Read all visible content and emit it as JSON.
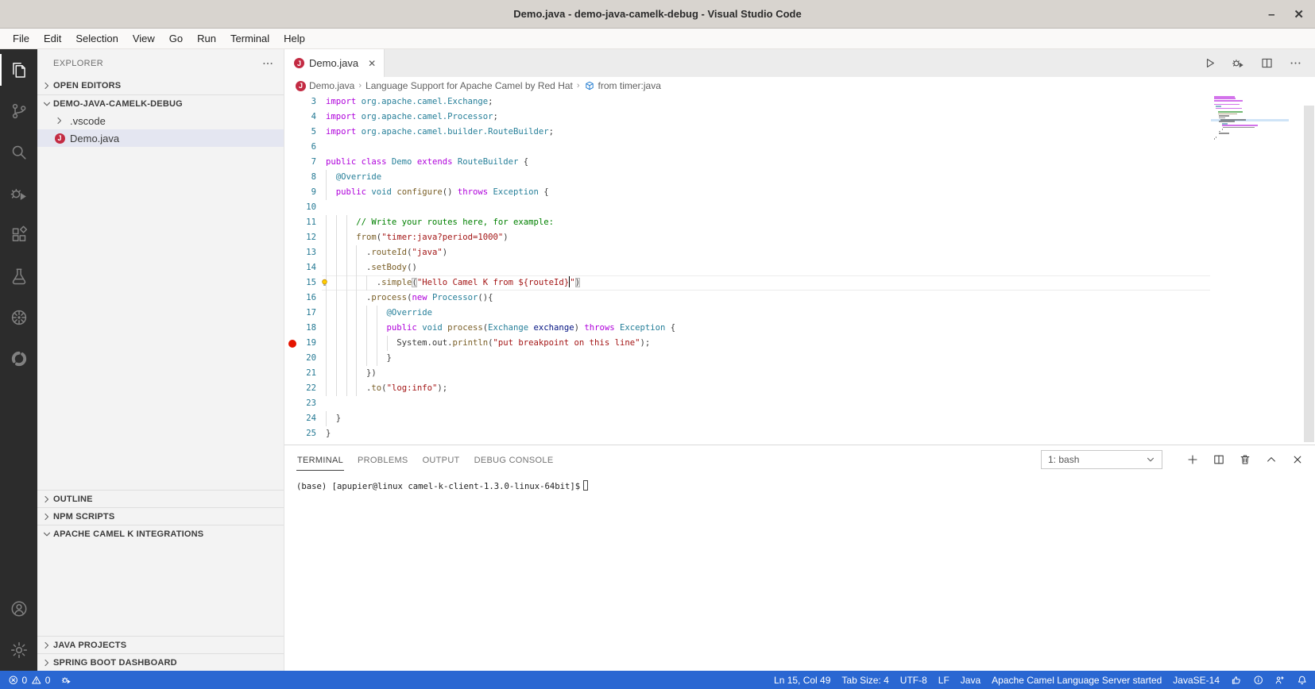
{
  "window": {
    "title": "Demo.java - demo-java-camelk-debug - Visual Studio Code",
    "controls": [
      {
        "name": "minimize-button",
        "glyph": "–"
      },
      {
        "name": "close-window-button",
        "glyph": "✕"
      }
    ]
  },
  "menu": {
    "items": [
      "File",
      "Edit",
      "Selection",
      "View",
      "Go",
      "Run",
      "Terminal",
      "Help"
    ]
  },
  "activity_bar": {
    "top": [
      {
        "name": "explorer",
        "icon": "files-icon",
        "active": true
      },
      {
        "name": "source-control",
        "icon": "source-control-icon",
        "active": false
      },
      {
        "name": "search",
        "icon": "search-icon",
        "active": false
      },
      {
        "name": "run-and-debug",
        "icon": "debug-alt-icon",
        "active": false
      },
      {
        "name": "extensions",
        "icon": "extensions-icon",
        "active": false
      },
      {
        "name": "testing",
        "icon": "beaker-icon",
        "active": false
      },
      {
        "name": "kubernetes",
        "icon": "kubernetes-icon",
        "active": false
      },
      {
        "name": "camel-k",
        "icon": "camel-k-icon",
        "active": false
      }
    ],
    "bottom": [
      {
        "name": "accounts",
        "icon": "account-icon",
        "active": false
      },
      {
        "name": "settings",
        "icon": "gear-icon",
        "active": false
      }
    ]
  },
  "sidebar": {
    "header": "EXPLORER",
    "top_rows": [
      {
        "kind": "section",
        "label": "OPEN EDITORS",
        "chevron": "right"
      },
      {
        "kind": "section",
        "label": "DEMO-JAVA-CAMELK-DEBUG",
        "chevron": "down",
        "border_top": true
      },
      {
        "kind": "folder",
        "label": ".vscode",
        "chevron": "right"
      },
      {
        "kind": "file",
        "label": "Demo.java",
        "icon": "java-file-icon",
        "selected": true
      }
    ],
    "bottom_rows": [
      {
        "kind": "section",
        "label": "OUTLINE",
        "chevron": "right",
        "border_top": true
      },
      {
        "kind": "section",
        "label": "NPM SCRIPTS",
        "chevron": "right",
        "border_top": true
      },
      {
        "kind": "section",
        "label": "APACHE CAMEL K INTEGRATIONS",
        "chevron": "down",
        "border_top": true
      },
      {
        "kind": "spacer",
        "height": 118
      },
      {
        "kind": "section",
        "label": "JAVA PROJECTS",
        "chevron": "right",
        "border_top": true
      },
      {
        "kind": "section",
        "label": "SPRING BOOT DASHBOARD",
        "chevron": "right",
        "border_top": true
      }
    ]
  },
  "editor": {
    "tab": {
      "label": "Demo.java",
      "icon": "java-file-icon",
      "close_glyph": "✕"
    },
    "actions": [
      {
        "name": "run-file",
        "icon": "run-icon"
      },
      {
        "name": "debug-run-file",
        "icon": "debug-alt-icon"
      },
      {
        "name": "split-editor",
        "icon": "split-icon"
      },
      {
        "name": "more-actions",
        "icon": "ellipsis-icon"
      }
    ],
    "breadcrumb": [
      {
        "label": "Demo.java",
        "icon": "java-file-icon"
      },
      {
        "label": "Language Support for Apache Camel by Red Hat"
      },
      {
        "label": "from timer:java",
        "icon": "camel-route-icon"
      }
    ],
    "code": {
      "first_line": 3,
      "current_line": 15,
      "breakpoint_lines": [
        19
      ],
      "lightbulb_line": 15,
      "lines": [
        {
          "n": 3,
          "s": [
            {
              "c": "kw",
              "t": "import "
            },
            {
              "c": "type",
              "t": "org.apache.camel.Exchange"
            },
            {
              "c": "plain",
              "t": ";"
            }
          ]
        },
        {
          "n": 4,
          "s": [
            {
              "c": "kw",
              "t": "import "
            },
            {
              "c": "type",
              "t": "org.apache.camel.Processor"
            },
            {
              "c": "plain",
              "t": ";"
            }
          ]
        },
        {
          "n": 5,
          "s": [
            {
              "c": "kw",
              "t": "import "
            },
            {
              "c": "type",
              "t": "org.apache.camel.builder.RouteBuilder"
            },
            {
              "c": "plain",
              "t": ";"
            }
          ]
        },
        {
          "n": 6,
          "s": []
        },
        {
          "n": 7,
          "s": [
            {
              "c": "kw",
              "t": "public class "
            },
            {
              "c": "type",
              "t": "Demo"
            },
            {
              "c": "kw",
              "t": " extends "
            },
            {
              "c": "type",
              "t": "RouteBuilder"
            },
            {
              "c": "plain",
              "t": " {"
            }
          ]
        },
        {
          "n": 8,
          "s": [
            {
              "c": "plain",
              "t": "  "
            },
            {
              "c": "type",
              "t": "@Override"
            }
          ]
        },
        {
          "n": 9,
          "s": [
            {
              "c": "plain",
              "t": "  "
            },
            {
              "c": "kw",
              "t": "public "
            },
            {
              "c": "type",
              "t": "void "
            },
            {
              "c": "method",
              "t": "configure"
            },
            {
              "c": "plain",
              "t": "() "
            },
            {
              "c": "kw",
              "t": "throws "
            },
            {
              "c": "type",
              "t": "Exception"
            },
            {
              "c": "plain",
              "t": " {"
            }
          ]
        },
        {
          "n": 10,
          "s": []
        },
        {
          "n": 11,
          "s": [
            {
              "c": "comment",
              "t": "      // Write your routes here, for example:"
            }
          ]
        },
        {
          "n": 12,
          "s": [
            {
              "c": "plain",
              "t": "      "
            },
            {
              "c": "method",
              "t": "from"
            },
            {
              "c": "plain",
              "t": "("
            },
            {
              "c": "string",
              "t": "\"timer:java?period=1000\""
            },
            {
              "c": "plain",
              "t": ")"
            }
          ]
        },
        {
          "n": 13,
          "s": [
            {
              "c": "plain",
              "t": "        ."
            },
            {
              "c": "method",
              "t": "routeId"
            },
            {
              "c": "plain",
              "t": "("
            },
            {
              "c": "string",
              "t": "\"java\""
            },
            {
              "c": "plain",
              "t": ")"
            }
          ]
        },
        {
          "n": 14,
          "s": [
            {
              "c": "plain",
              "t": "        ."
            },
            {
              "c": "method",
              "t": "setBody"
            },
            {
              "c": "plain",
              "t": "()"
            }
          ]
        },
        {
          "n": 15,
          "s": [
            {
              "c": "plain",
              "t": "          ."
            },
            {
              "c": "method",
              "t": "simple"
            },
            {
              "c": "plain",
              "t": "(",
              "bracket": true
            },
            {
              "c": "string",
              "t": "\"Hello Camel K from ${routeId}"
            },
            {
              "cursor": true
            },
            {
              "c": "string",
              "t": "\""
            },
            {
              "c": "plain",
              "t": ")",
              "bracket": true
            }
          ]
        },
        {
          "n": 16,
          "s": [
            {
              "c": "plain",
              "t": "        ."
            },
            {
              "c": "method",
              "t": "process"
            },
            {
              "c": "plain",
              "t": "("
            },
            {
              "c": "kw",
              "t": "new "
            },
            {
              "c": "type",
              "t": "Processor"
            },
            {
              "c": "plain",
              "t": "(){"
            }
          ]
        },
        {
          "n": 17,
          "s": [
            {
              "c": "plain",
              "t": "            "
            },
            {
              "c": "type",
              "t": "@Override"
            }
          ]
        },
        {
          "n": 18,
          "s": [
            {
              "c": "plain",
              "t": "            "
            },
            {
              "c": "kw",
              "t": "public "
            },
            {
              "c": "type",
              "t": "void "
            },
            {
              "c": "method",
              "t": "process"
            },
            {
              "c": "plain",
              "t": "("
            },
            {
              "c": "type",
              "t": "Exchange "
            },
            {
              "c": "param",
              "t": "exchange"
            },
            {
              "c": "plain",
              "t": ") "
            },
            {
              "c": "kw",
              "t": "throws "
            },
            {
              "c": "type",
              "t": "Exception"
            },
            {
              "c": "plain",
              "t": " {"
            }
          ]
        },
        {
          "n": 19,
          "s": [
            {
              "c": "plain",
              "t": "              System.out."
            },
            {
              "c": "method",
              "t": "println"
            },
            {
              "c": "plain",
              "t": "("
            },
            {
              "c": "string",
              "t": "\"put breakpoint on this line\""
            },
            {
              "c": "plain",
              "t": ");"
            }
          ]
        },
        {
          "n": 20,
          "s": [
            {
              "c": "plain",
              "t": "            }"
            }
          ]
        },
        {
          "n": 21,
          "s": [
            {
              "c": "plain",
              "t": "        })"
            }
          ]
        },
        {
          "n": 22,
          "s": [
            {
              "c": "plain",
              "t": "        ."
            },
            {
              "c": "method",
              "t": "to"
            },
            {
              "c": "plain",
              "t": "("
            },
            {
              "c": "string",
              "t": "\"log:info\""
            },
            {
              "c": "plain",
              "t": ");"
            }
          ]
        },
        {
          "n": 23,
          "s": []
        },
        {
          "n": 24,
          "s": [
            {
              "c": "plain",
              "t": "  }"
            }
          ]
        },
        {
          "n": 25,
          "s": [
            {
              "c": "plain",
              "t": "}"
            }
          ]
        }
      ]
    }
  },
  "panel": {
    "tabs": [
      {
        "label": "TERMINAL",
        "active": true
      },
      {
        "label": "PROBLEMS",
        "active": false
      },
      {
        "label": "OUTPUT",
        "active": false
      },
      {
        "label": "DEBUG CONSOLE",
        "active": false
      }
    ],
    "select_value": "1: bash",
    "actions": [
      {
        "name": "new-terminal",
        "icon": "plus-icon"
      },
      {
        "name": "split-terminal",
        "icon": "split-icon"
      },
      {
        "name": "kill-terminal",
        "icon": "trash-icon"
      },
      {
        "name": "maximize-panel",
        "icon": "chevron-up-icon"
      },
      {
        "name": "close-panel",
        "icon": "close-icon"
      }
    ],
    "terminal": {
      "prompt": "(base) [apupier@linux camel-k-client-1.3.0-linux-64bit]$",
      "cursor": true
    }
  },
  "status_bar": {
    "left": [
      {
        "name": "error-count",
        "icon": "error-icon",
        "text": "0"
      },
      {
        "name": "warning-count",
        "icon": "warning-icon",
        "text": "0"
      },
      {
        "name": "debug-status",
        "icon": "debug-alt-icon",
        "text": "",
        "gap": true
      }
    ],
    "right": [
      {
        "name": "cursor-position",
        "text": "Ln 15, Col 49"
      },
      {
        "name": "indentation",
        "text": "Tab Size: 4"
      },
      {
        "name": "encoding",
        "text": "UTF-8"
      },
      {
        "name": "end-of-line",
        "text": "LF"
      },
      {
        "name": "language-mode",
        "text": "Java"
      },
      {
        "name": "camel-language-server-status",
        "text": "Apache Camel Language Server started"
      },
      {
        "name": "java-runtime",
        "text": "JavaSE-14"
      },
      {
        "name": "thumbs-up",
        "icon": "thumbsup-icon"
      },
      {
        "name": "java-info",
        "icon": "info-icon"
      },
      {
        "name": "share-feedback",
        "icon": "person-arrow-icon"
      },
      {
        "name": "notifications",
        "icon": "bell-icon"
      }
    ]
  },
  "colors": {
    "statusbar_bg": "#2a67d2",
    "activitybar_bg": "#2c2c2c",
    "sidebar_bg": "#f3f3f3",
    "selection_bg": "#e4e6f1",
    "breakpoint": "#e51400",
    "lightbulb": "#ffcc00",
    "java_icon": "#c32b43",
    "camel_icon": "#1f7ad0",
    "syntax": {
      "kw": "#AF00DB",
      "type": "#267F99",
      "method": "#795E26",
      "string": "#A31515",
      "comment": "#008000",
      "plain": "#3B3B3B",
      "param": "#001080",
      "line_number": "#237893"
    }
  }
}
